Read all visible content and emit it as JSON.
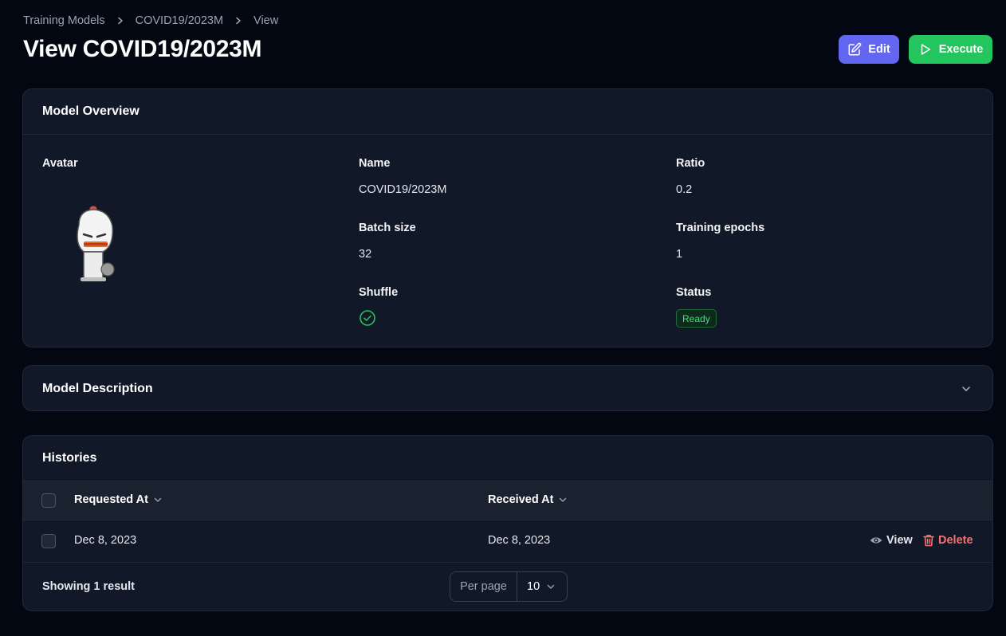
{
  "breadcrumb": [
    "Training Models",
    "COVID19/2023M",
    "View"
  ],
  "page_title": "View COVID19/2023M",
  "actions": {
    "edit": "Edit",
    "execute": "Execute"
  },
  "overview": {
    "title": "Model Overview",
    "avatar_label": "Avatar",
    "name_label": "Name",
    "name_value": "COVID19/2023M",
    "ratio_label": "Ratio",
    "ratio_value": "0.2",
    "batch_label": "Batch size",
    "batch_value": "32",
    "epochs_label": "Training epochs",
    "epochs_value": "1",
    "shuffle_label": "Shuffle",
    "shuffle_value": true,
    "status_label": "Status",
    "status_value": "Ready"
  },
  "description": {
    "title": "Model Description"
  },
  "histories": {
    "title": "Histories",
    "columns": [
      "Requested At",
      "Received At"
    ],
    "rows": [
      {
        "requested_at": "Dec 8, 2023",
        "received_at": "Dec 8, 2023",
        "view": "View",
        "delete": "Delete"
      }
    ],
    "footer_text": "Showing 1 result",
    "per_page_label": "Per page",
    "per_page_value": "10"
  },
  "colors": {
    "background": "#030712",
    "card": "#111827",
    "primary": "#6366f1",
    "success": "#22c55e",
    "danger": "#f87171"
  }
}
